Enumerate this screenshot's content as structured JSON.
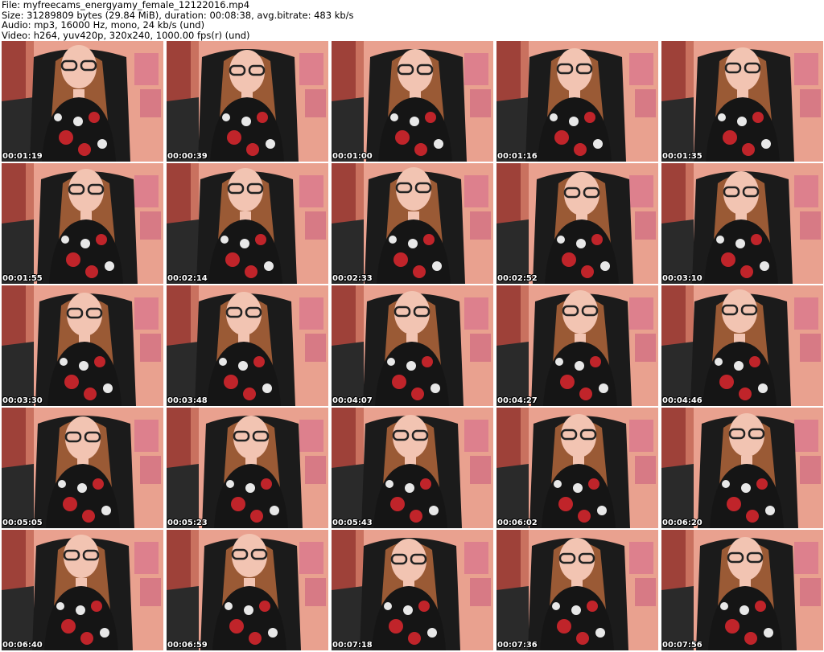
{
  "header": {
    "file_line": "File: myfreecams_energyamy_female_12122016.mp4",
    "size_line": "Size: 31289809 bytes (29.84 MiB), duration: 00:08:38, avg.bitrate: 483 kb/s",
    "audio_line": "Audio: mp3, 16000 Hz, mono, 24 kb/s (und)",
    "video_line": "Video: h264, yuv420p, 320x240, 1000.00 fps(r) (und)"
  },
  "thumbnails": [
    {
      "timestamp": "00:01:19"
    },
    {
      "timestamp": "00:00:39"
    },
    {
      "timestamp": "00:01:00"
    },
    {
      "timestamp": "00:01:16"
    },
    {
      "timestamp": "00:01:35"
    },
    {
      "timestamp": "00:01:55"
    },
    {
      "timestamp": "00:02:14"
    },
    {
      "timestamp": "00:02:33"
    },
    {
      "timestamp": "00:02:52"
    },
    {
      "timestamp": "00:03:10"
    },
    {
      "timestamp": "00:03:30"
    },
    {
      "timestamp": "00:03:48"
    },
    {
      "timestamp": "00:04:07"
    },
    {
      "timestamp": "00:04:27"
    },
    {
      "timestamp": "00:04:46"
    },
    {
      "timestamp": "00:05:05"
    },
    {
      "timestamp": "00:05:23"
    },
    {
      "timestamp": "00:05:43"
    },
    {
      "timestamp": "00:06:02"
    },
    {
      "timestamp": "00:06:20"
    },
    {
      "timestamp": "00:06:40"
    },
    {
      "timestamp": "00:06:59"
    },
    {
      "timestamp": "00:07:18"
    },
    {
      "timestamp": "00:07:36"
    },
    {
      "timestamp": "00:07:56"
    }
  ],
  "colors": {
    "wall": "#e9a18f",
    "wall_shadow": "#c9715f",
    "chair": "#1b1b1b",
    "hair": "#9a5a35",
    "skin": "#f2c4b2",
    "dress": "#151515",
    "flower_red": "#c0242a",
    "flower_white": "#e8e8e8",
    "timestamp_text": "#ffffff"
  }
}
